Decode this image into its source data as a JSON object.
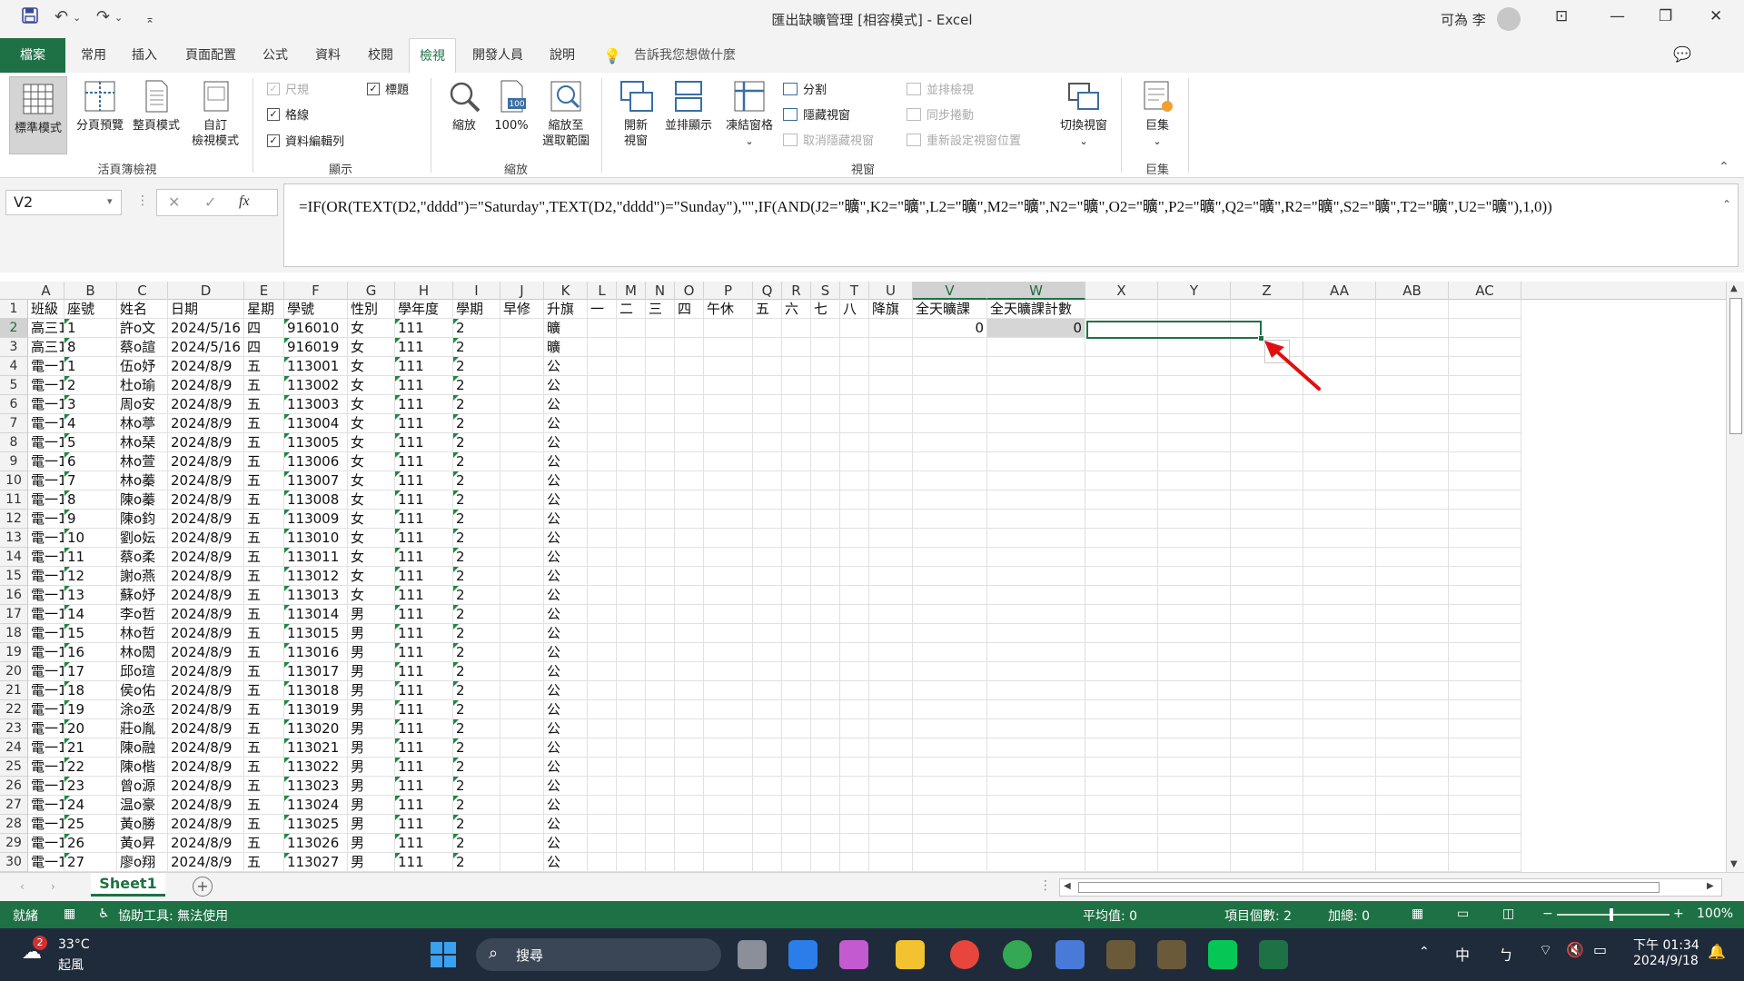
{
  "titlebar": {
    "title": "匯出缺曠管理 [相容模式] - Excel",
    "user": "可為 李",
    "icons": [
      "save-icon",
      "undo-icon",
      "redo-icon",
      "customize-icon"
    ]
  },
  "tabs": [
    "檔案",
    "常用",
    "插入",
    "頁面配置",
    "公式",
    "資料",
    "校閱",
    "檢視",
    "開發人員",
    "說明"
  ],
  "active_tab": "檢視",
  "tell_me": "告訴我您想做什麼",
  "ribbon": {
    "workbook_views": {
      "label": "活頁簿檢視",
      "normal": "標準模式",
      "page_break": "分頁預覽",
      "page_layout": "整頁模式",
      "custom_line1": "自訂",
      "custom_line2": "檢視模式"
    },
    "show": {
      "label": "顯示",
      "ruler": "尺規",
      "gridlines": "格線",
      "formula_bar": "資料編輯列",
      "headings": "標題"
    },
    "zoom": {
      "label": "縮放",
      "zoom": "縮放",
      "hundred": "100%",
      "zoom_sel_line1": "縮放至",
      "zoom_sel_line2": "選取範圍",
      "badge": "100"
    },
    "window": {
      "label": "視窗",
      "new_line1": "開新",
      "new_line2": "視窗",
      "arrange": "並排顯示",
      "freeze": "凍結窗格",
      "split": "分割",
      "hide": "隱藏視窗",
      "unhide": "取消隱藏視窗",
      "side_by_side": "並排檢視",
      "sync_scroll": "同步捲動",
      "reset_pos": "重新設定視窗位置",
      "switch": "切換視窗"
    },
    "macros": {
      "label": "巨集",
      "macros": "巨集"
    }
  },
  "formula_bar": {
    "name_box": "V2",
    "fx": "fx",
    "formula": "=IF(OR(TEXT(D2,\"dddd\")=\"Saturday\",TEXT(D2,\"dddd\")=\"Sunday\"),\"\",IF(AND(J2=\"曠\",K2=\"曠\",L2=\"曠\",M2=\"曠\",N2=\"曠\",O2=\"曠\",P2=\"曠\",Q2=\"曠\",R2=\"曠\",S2=\"曠\",T2=\"曠\",U2=\"曠\"),1,0))"
  },
  "columns": [
    "A",
    "B",
    "C",
    "D",
    "E",
    "F",
    "G",
    "H",
    "I",
    "J",
    "K",
    "L",
    "M",
    "N",
    "O",
    "P",
    "Q",
    "R",
    "S",
    "T",
    "U",
    "V",
    "W",
    "X",
    "Y",
    "Z",
    "AA",
    "AB",
    "AC"
  ],
  "headers": [
    "班級",
    "座號",
    "姓名",
    "日期",
    "星期",
    "學號",
    "性別",
    "學年度",
    "學期",
    "早修",
    "升旗",
    "一",
    "二",
    "三",
    "四",
    "午休",
    "五",
    "六",
    "七",
    "八",
    "降旗",
    "全天曠課",
    "全天曠課計數"
  ],
  "rows": [
    [
      "高三1",
      "1",
      "許o文",
      "2024/5/16",
      "四",
      "916010",
      "女",
      "111",
      "2",
      "",
      "曠",
      "0",
      "0"
    ],
    [
      "高三1",
      "8",
      "蔡o諠",
      "2024/5/16",
      "四",
      "916019",
      "女",
      "111",
      "2",
      "",
      "曠",
      "",
      ""
    ],
    [
      "電一1",
      "1",
      "伍o妤",
      "2024/8/9",
      "五",
      "113001",
      "女",
      "111",
      "2",
      "",
      "公",
      "",
      ""
    ],
    [
      "電一1",
      "2",
      "杜o瑜",
      "2024/8/9",
      "五",
      "113002",
      "女",
      "111",
      "2",
      "",
      "公",
      "",
      ""
    ],
    [
      "電一1",
      "3",
      "周o安",
      "2024/8/9",
      "五",
      "113003",
      "女",
      "111",
      "2",
      "",
      "公",
      "",
      ""
    ],
    [
      "電一1",
      "4",
      "林o葶",
      "2024/8/9",
      "五",
      "113004",
      "女",
      "111",
      "2",
      "",
      "公",
      "",
      ""
    ],
    [
      "電一1",
      "5",
      "林o琹",
      "2024/8/9",
      "五",
      "113005",
      "女",
      "111",
      "2",
      "",
      "公",
      "",
      ""
    ],
    [
      "電一1",
      "6",
      "林o萱",
      "2024/8/9",
      "五",
      "113006",
      "女",
      "111",
      "2",
      "",
      "公",
      "",
      ""
    ],
    [
      "電一1",
      "7",
      "林o蓁",
      "2024/8/9",
      "五",
      "113007",
      "女",
      "111",
      "2",
      "",
      "公",
      "",
      ""
    ],
    [
      "電一1",
      "8",
      "陳o蓁",
      "2024/8/9",
      "五",
      "113008",
      "女",
      "111",
      "2",
      "",
      "公",
      "",
      ""
    ],
    [
      "電一1",
      "9",
      "陳o鈞",
      "2024/8/9",
      "五",
      "113009",
      "女",
      "111",
      "2",
      "",
      "公",
      "",
      ""
    ],
    [
      "電一1",
      "10",
      "劉o妘",
      "2024/8/9",
      "五",
      "113010",
      "女",
      "111",
      "2",
      "",
      "公",
      "",
      ""
    ],
    [
      "電一1",
      "11",
      "蔡o柔",
      "2024/8/9",
      "五",
      "113011",
      "女",
      "111",
      "2",
      "",
      "公",
      "",
      ""
    ],
    [
      "電一1",
      "12",
      "謝o燕",
      "2024/8/9",
      "五",
      "113012",
      "女",
      "111",
      "2",
      "",
      "公",
      "",
      ""
    ],
    [
      "電一1",
      "13",
      "蘇o妤",
      "2024/8/9",
      "五",
      "113013",
      "女",
      "111",
      "2",
      "",
      "公",
      "",
      ""
    ],
    [
      "電一1",
      "14",
      "李o哲",
      "2024/8/9",
      "五",
      "113014",
      "男",
      "111",
      "2",
      "",
      "公",
      "",
      ""
    ],
    [
      "電一1",
      "15",
      "林o哲",
      "2024/8/9",
      "五",
      "113015",
      "男",
      "111",
      "2",
      "",
      "公",
      "",
      ""
    ],
    [
      "電一1",
      "16",
      "林o閎",
      "2024/8/9",
      "五",
      "113016",
      "男",
      "111",
      "2",
      "",
      "公",
      "",
      ""
    ],
    [
      "電一1",
      "17",
      "邱o瑄",
      "2024/8/9",
      "五",
      "113017",
      "男",
      "111",
      "2",
      "",
      "公",
      "",
      ""
    ],
    [
      "電一1",
      "18",
      "侯o佑",
      "2024/8/9",
      "五",
      "113018",
      "男",
      "111",
      "2",
      "",
      "公",
      "",
      ""
    ],
    [
      "電一1",
      "19",
      "涂o丞",
      "2024/8/9",
      "五",
      "113019",
      "男",
      "111",
      "2",
      "",
      "公",
      "",
      ""
    ],
    [
      "電一1",
      "20",
      "莊o胤",
      "2024/8/9",
      "五",
      "113020",
      "男",
      "111",
      "2",
      "",
      "公",
      "",
      ""
    ],
    [
      "電一1",
      "21",
      "陳o融",
      "2024/8/9",
      "五",
      "113021",
      "男",
      "111",
      "2",
      "",
      "公",
      "",
      ""
    ],
    [
      "電一1",
      "22",
      "陳o楷",
      "2024/8/9",
      "五",
      "113022",
      "男",
      "111",
      "2",
      "",
      "公",
      "",
      ""
    ],
    [
      "電一1",
      "23",
      "曾o源",
      "2024/8/9",
      "五",
      "113023",
      "男",
      "111",
      "2",
      "",
      "公",
      "",
      ""
    ],
    [
      "電一1",
      "24",
      "温o豪",
      "2024/8/9",
      "五",
      "113024",
      "男",
      "111",
      "2",
      "",
      "公",
      "",
      ""
    ],
    [
      "電一1",
      "25",
      "黃o勝",
      "2024/8/9",
      "五",
      "113025",
      "男",
      "111",
      "2",
      "",
      "公",
      "",
      ""
    ],
    [
      "電一1",
      "26",
      "黃o昇",
      "2024/8/9",
      "五",
      "113026",
      "男",
      "111",
      "2",
      "",
      "公",
      "",
      ""
    ],
    [
      "電一1",
      "27",
      "廖o翔",
      "2024/8/9",
      "五",
      "113027",
      "男",
      "111",
      "2",
      "",
      "公",
      "",
      ""
    ]
  ],
  "sheet_tab": "Sheet1",
  "status": {
    "ready": "就緒",
    "accessibility": "協助工具: 無法使用",
    "average": "平均值: 0",
    "count": "項目個數: 2",
    "sum": "加總: 0",
    "zoom": "100%"
  },
  "taskbar": {
    "weather_temp": "33°C",
    "weather_text": "起風",
    "weather_badge": "2",
    "search": "搜尋",
    "ime": "中",
    "time": "下午 01:34",
    "date": "2024/9/18"
  },
  "colors": {
    "excel_green": "#1e7145",
    "arrow": "#e01010"
  }
}
